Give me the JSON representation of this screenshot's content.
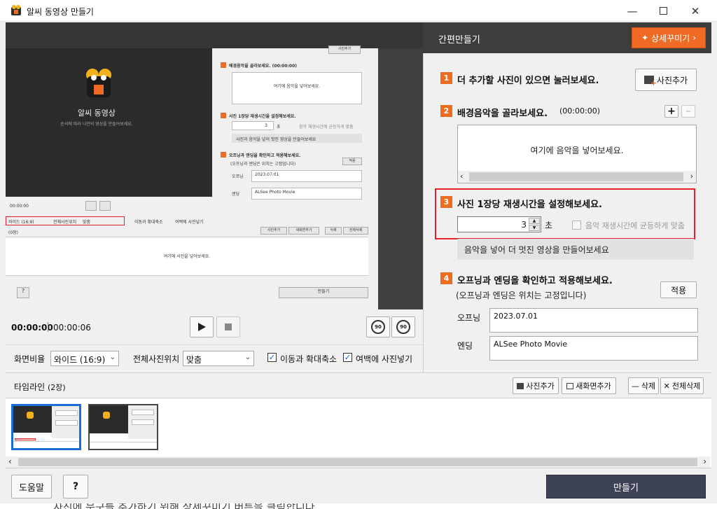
{
  "window": {
    "title": "알씨 동영상 만들기",
    "minimize_icon": "minimize-icon",
    "maximize_icon": "maximize-icon",
    "close_icon": "close-icon"
  },
  "preview": {
    "logo_name": "알씨 동영상",
    "logo_sub": "순서에 따라 나만의 영상을 만들어보세요.",
    "mini": {
      "step2": "배경음악을 골라보세요. (00:00:00)",
      "music_placeholder": "여기에 음악을 넣어보세요.",
      "step3": "사진 1장당 재생시간을 설정해보세요.",
      "step3_value": "3",
      "step3_unit": "초",
      "step3_check": "음악 재생시간에 균등하게 맞춤",
      "step3_info": "사진과 음악을 넣어 멋진 영상을 만들어보세요",
      "step4": "오프닝과 엔딩을 확인하고 적용해보세요.",
      "step4_sub": "(오프닝과 엔딩은 위치는 고정입니다)",
      "apply": "적용",
      "opening_label": "오프닝",
      "opening_value": "2023.07.01",
      "ending_label": "엔딩",
      "ending_value": "ALSee Photo Movie",
      "add_photo": "사진추가",
      "time": "00:00:00",
      "ratio": "와이드 (16:9)",
      "position_label": "전체사진위치",
      "position_value": "맞춤",
      "check1": "이동과 확대축소",
      "check2": "여백에 사진넣기",
      "tl_title": "(0장)",
      "tl_add": "사진추가",
      "tl_new": "새화면추가",
      "tl_del": "삭제",
      "tl_delall": "전체삭제",
      "tl_placeholder": "여기에 사진을 넣어보세요.",
      "help": "?",
      "make": "만들기"
    }
  },
  "player": {
    "current_time": "00:00:00",
    "total_time": "00:00:06",
    "play_icon": "play-icon",
    "stop_icon": "stop-icon",
    "rotate_left_label": "90",
    "rotate_right_label": "90"
  },
  "options": {
    "ratio_label": "화면비율",
    "ratio_value": "와이드 (16:9)",
    "position_label": "전체사진위치",
    "position_value": "맞춤",
    "move_zoom_label": "이동과 확대축소",
    "move_zoom_checked": true,
    "margin_photo_label": "여백에 사진넣기",
    "margin_photo_checked": true
  },
  "panel": {
    "title": "간편만들기",
    "detail_button": "상세꾸미기",
    "step1": {
      "num": "1",
      "title": "더 추가할 사진이 있으면 눌러보세요.",
      "button": "사진추가"
    },
    "step2": {
      "num": "2",
      "title": "배경음악을 골라보세요.",
      "duration": "(00:00:00)",
      "placeholder": "여기에 음악을 넣어보세요."
    },
    "step3": {
      "num": "3",
      "title": "사진 1장당 재생시간을 설정해보세요.",
      "value": "3",
      "unit": "초",
      "checkbox_label": "음악 재생시간에 균등하게 맞춤",
      "info": "음악을 넣어 더 멋진 영상을 만들어보세요"
    },
    "step4": {
      "num": "4",
      "title": "오프닝과 엔딩을 확인하고 적용해보세요.",
      "subtitle": "(오프닝과 엔딩은 위치는 고정입니다)",
      "apply_button": "적용",
      "opening_label": "오프닝",
      "opening_value": "2023.07.01",
      "ending_label": "엔딩",
      "ending_value": "ALSee Photo Movie"
    }
  },
  "timeline": {
    "title": "타임라인",
    "count": "(2장)",
    "add_photo": "사진추가",
    "add_screen": "새화면추가",
    "delete": "삭제",
    "delete_all": "전체삭제",
    "selected_index": 0
  },
  "footer": {
    "help": "도움말",
    "question": "?",
    "make": "만들기"
  },
  "background_text": "사진에 문구를 추가하기 위해 상세꾸미기 버튼을 클릭합니다",
  "colors": {
    "accent": "#ee6c1f",
    "highlight": "#e41e2b",
    "selected": "#1670d4",
    "make_button": "#3e4256"
  }
}
